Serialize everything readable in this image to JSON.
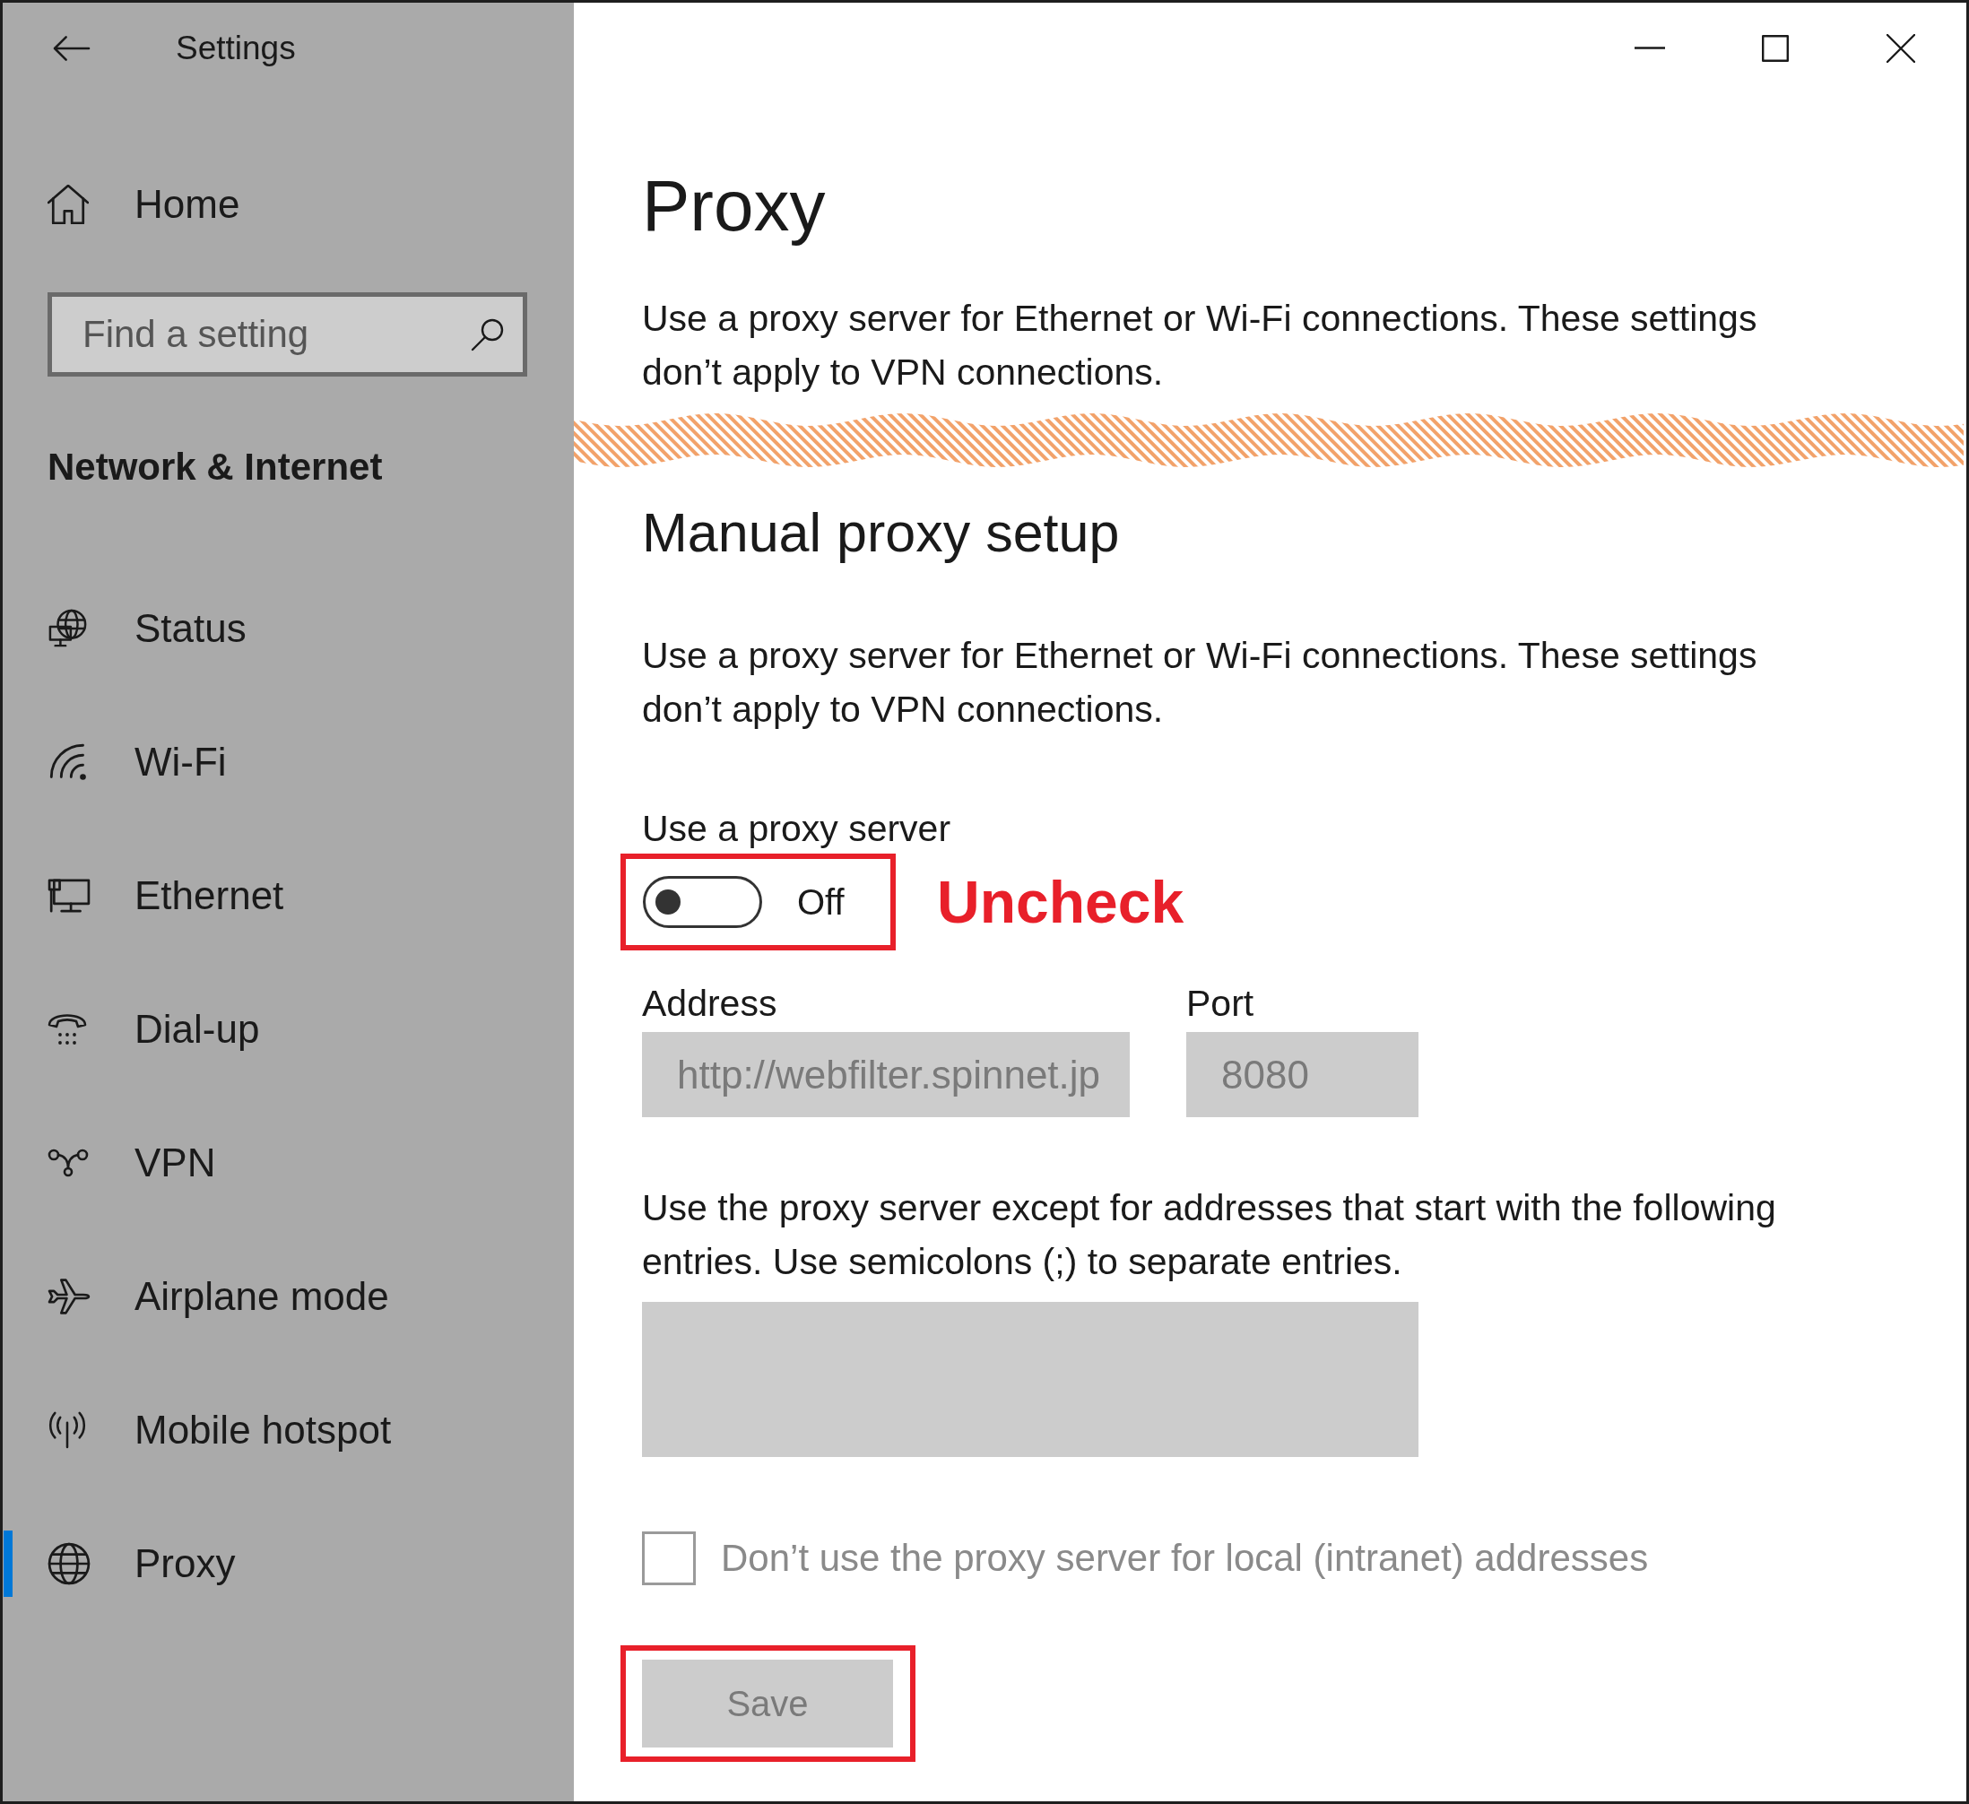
{
  "window": {
    "title": "Settings"
  },
  "sidebar": {
    "home": {
      "label": "Home"
    },
    "search": {
      "placeholder": "Find a setting"
    },
    "section_title": "Network & Internet",
    "items": [
      {
        "label": "Status",
        "selected": false
      },
      {
        "label": "Wi-Fi",
        "selected": false
      },
      {
        "label": "Ethernet",
        "selected": false
      },
      {
        "label": "Dial-up",
        "selected": false
      },
      {
        "label": "VPN",
        "selected": false
      },
      {
        "label": "Airplane mode",
        "selected": false
      },
      {
        "label": "Mobile hotspot",
        "selected": false
      },
      {
        "label": "Proxy",
        "selected": true
      }
    ]
  },
  "page": {
    "title": "Proxy",
    "intro": "Use a proxy server for Ethernet or Wi-Fi connections. These settings don’t apply to VPN connections.",
    "manual_setup": {
      "heading": "Manual proxy setup",
      "description": "Use a proxy server for Ethernet or Wi-Fi connections. These settings don’t apply to VPN connections.",
      "use_proxy": {
        "label": "Use a proxy server",
        "on": false,
        "state_text": "Off",
        "highlighted": true,
        "callout": "Uncheck"
      },
      "address": {
        "label": "Address",
        "value": "http://webfilter.spinnet.jp",
        "disabled": true
      },
      "port": {
        "label": "Port",
        "value": "8080",
        "disabled": true
      },
      "exceptions": {
        "label": "Use the proxy server except for addresses that start with the following entries. Use semicolons (;) to separate entries.",
        "disabled": true
      },
      "bypass_local": {
        "label": "Don’t use the proxy server for local (intranet) addresses",
        "checked": false,
        "disabled": true
      },
      "save_button": {
        "label": "Save",
        "disabled": true,
        "highlighted": true
      }
    }
  }
}
